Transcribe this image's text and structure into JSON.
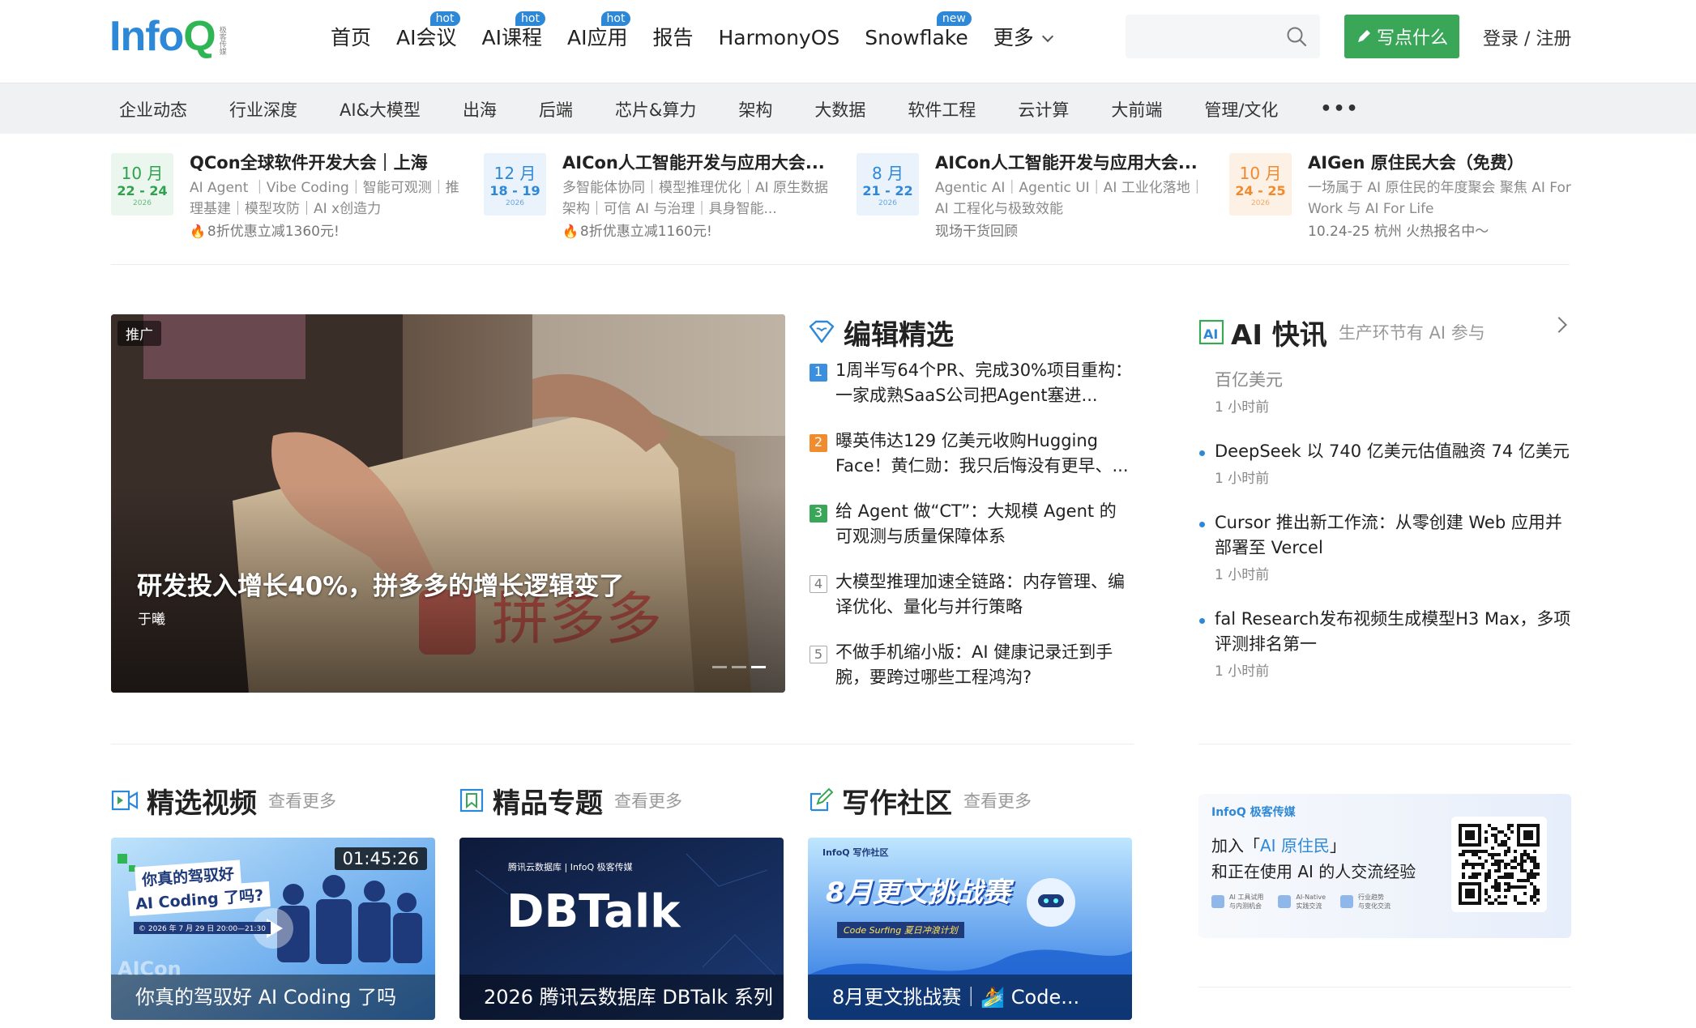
{
  "header": {
    "logo_main": "Info",
    "logo_q": "Q",
    "logo_sub": "极客传媒",
    "nav": [
      {
        "label": "首页",
        "badge": ""
      },
      {
        "label": "AI会议",
        "badge": "hot"
      },
      {
        "label": "AI课程",
        "badge": "hot"
      },
      {
        "label": "AI应用",
        "badge": "hot"
      },
      {
        "label": "报告",
        "badge": ""
      },
      {
        "label": "HarmonyOS",
        "badge": ""
      },
      {
        "label": "Snowflake",
        "badge": "new"
      },
      {
        "label": "更多",
        "badge": ""
      }
    ],
    "search_placeholder": "",
    "write_label": "写点什么",
    "login_label": "登录 / 注册"
  },
  "categories": [
    "企业动态",
    "行业深度",
    "AI&大模型",
    "出海",
    "后端",
    "芯片&算力",
    "架构",
    "大数据",
    "软件工程",
    "云计算",
    "大前端",
    "管理/文化"
  ],
  "categories_more": "•••",
  "events": [
    {
      "month": "10 月",
      "days": "22 - 24",
      "year": "2026",
      "color": "#2fa24d",
      "bg": "#eaf6ee",
      "title": "QCon全球软件开发大会｜上海",
      "desc": "AI Agent ｜Vibe Coding｜智能可观测｜推理基建｜模型攻防｜AI x创造力",
      "foot": "8折优惠立减1360元!",
      "fire": true
    },
    {
      "month": "12 月",
      "days": "18 - 19",
      "year": "2026",
      "color": "#2e88d8",
      "bg": "#eaf2fb",
      "title": "AICon人工智能开发与应用大会...",
      "desc": "多智能体协同｜模型推理优化｜AI 原生数据架构｜可信 AI 与治理｜具身智能...",
      "foot": "8折优惠立减1160元!",
      "fire": true
    },
    {
      "month": "8 月",
      "days": "21 - 22",
      "year": "2026",
      "color": "#2e88d8",
      "bg": "#eaf2fb",
      "title": "AICon人工智能开发与应用大会...",
      "desc": "Agentic AI｜Agentic UI｜AI 工业化落地｜AI 工程化与极致效能",
      "foot": "现场干货回顾",
      "fire": false
    },
    {
      "month": "10 月",
      "days": "24 - 25",
      "year": "2026",
      "color": "#ef8a2e",
      "bg": "#fdf1e6",
      "title": "AIGen 原住民大会（免费）",
      "desc": "一场属于 AI 原住民的年度聚会 聚焦 AI For Work 与 AI For Life",
      "foot": "10.24-25 杭州 火热报名中～",
      "fire": false
    }
  ],
  "hero": {
    "promo": "推广",
    "title": "研发投入增长40%，拼多多的增长逻辑变了",
    "author": "于曦"
  },
  "picks": {
    "title": "编辑精选",
    "items": [
      {
        "num": "1",
        "color": "#3b8fde",
        "text": "1周半写64个PR、完成30%项目重构：一家成熟SaaS公司把Agent塞进..."
      },
      {
        "num": "2",
        "color": "#f08c2e",
        "text": "曝英伟达129 亿美元收购Hugging Face！黄仁勋：我只后悔没有更早、..."
      },
      {
        "num": "3",
        "color": "#3aa657",
        "text": "给 Agent 做“CT”：大规模 Agent 的可观测与质量保障体系"
      },
      {
        "num": "4",
        "color": "",
        "text": "大模型推理加速全链路：内存管理、编译优化、量化与并行策略"
      },
      {
        "num": "5",
        "color": "",
        "text": "不做手机缩小版：AI 健康记录迁到手腕，要跨过哪些工程鸿沟?"
      }
    ]
  },
  "news": {
    "title": "AI 快讯",
    "subtitle": "生产环节有 AI 参与",
    "partial_text": "百亿美元",
    "partial_time": "1 小时前",
    "items": [
      {
        "text": "DeepSeek 以 740 亿美元估值融资 74 亿美元",
        "time": "1 小时前"
      },
      {
        "text": "Cursor 推出新工作流：从零创建 Web 应用并部署至 Vercel",
        "time": "1 小时前"
      },
      {
        "text": "fal Research发布视频生成模型H3 Max，多项评测排名第一",
        "time": "1 小时前"
      }
    ]
  },
  "sections": [
    {
      "title": "精选视频",
      "more": "查看更多"
    },
    {
      "title": "精品专题",
      "more": "查看更多"
    },
    {
      "title": "写作社区",
      "more": "查看更多"
    }
  ],
  "cards": [
    {
      "caption": "你真的驾驭好 AI Coding 了吗",
      "duration": "01:45:26",
      "art_line1": "你真的驾驭好",
      "art_line2": "AI Coding 了吗?",
      "art_date": "© 2026 年 7 月 29 日 20:00—21:30"
    },
    {
      "caption": "2026 腾讯云数据库 DBTalk 系列",
      "art_brand": "腾讯云数据库 | InfoQ 极客传媒",
      "art_logo": "DBTalk"
    },
    {
      "caption": "8月更文挑战赛｜🏄 Code...",
      "art_brand": "InfoQ 写作社区",
      "art_title": "8月更文挑战赛",
      "art_sub": "Code Surfing 夏日冲浪计划"
    }
  ],
  "banner": {
    "brand": "InfoQ 极客传媒",
    "line1_pre": "加入「",
    "line1_hl": "AI 原住民",
    "line1_post": "」",
    "line2": "和正在使用 AI 的人交流经验",
    "features": [
      {
        "l1": "AI 工具试用",
        "l2": "与内测机会"
      },
      {
        "l1": "AI-Native",
        "l2": "实践交流"
      },
      {
        "l1": "行业趋势",
        "l2": "与变化交流"
      }
    ]
  }
}
